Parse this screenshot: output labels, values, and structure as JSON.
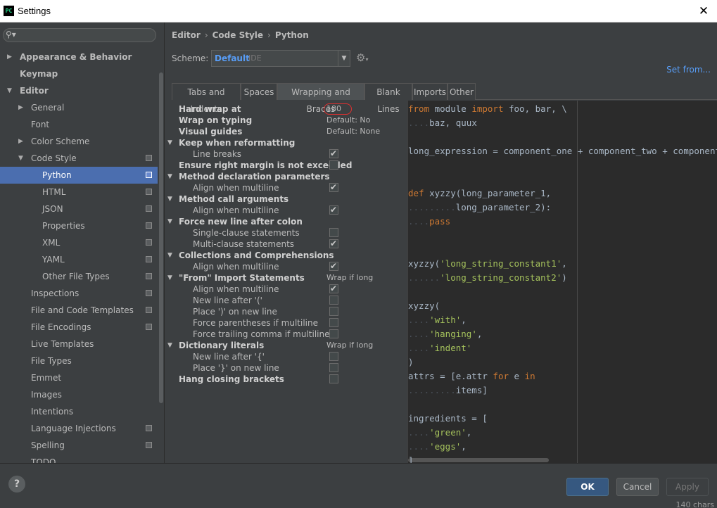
{
  "window": {
    "title": "Settings",
    "app_icon_text": "PC"
  },
  "search": {
    "placeholder": ""
  },
  "tree": [
    {
      "label": "Appearance & Behavior",
      "bold": true,
      "indent": 0,
      "arrow": "right",
      "proj": false
    },
    {
      "label": "Keymap",
      "bold": true,
      "indent": 0,
      "arrow": "",
      "proj": false
    },
    {
      "label": "Editor",
      "bold": true,
      "indent": 0,
      "arrow": "down",
      "proj": false
    },
    {
      "label": "General",
      "bold": false,
      "indent": 1,
      "arrow": "right",
      "proj": false
    },
    {
      "label": "Font",
      "bold": false,
      "indent": 1,
      "arrow": "",
      "proj": false
    },
    {
      "label": "Color Scheme",
      "bold": false,
      "indent": 1,
      "arrow": "right",
      "proj": false
    },
    {
      "label": "Code Style",
      "bold": false,
      "indent": 1,
      "arrow": "down",
      "proj": true
    },
    {
      "label": "Python",
      "bold": false,
      "indent": 2,
      "arrow": "",
      "proj": true,
      "selected": true
    },
    {
      "label": "HTML",
      "bold": false,
      "indent": 2,
      "arrow": "",
      "proj": true
    },
    {
      "label": "JSON",
      "bold": false,
      "indent": 2,
      "arrow": "",
      "proj": true
    },
    {
      "label": "Properties",
      "bold": false,
      "indent": 2,
      "arrow": "",
      "proj": true
    },
    {
      "label": "XML",
      "bold": false,
      "indent": 2,
      "arrow": "",
      "proj": true
    },
    {
      "label": "YAML",
      "bold": false,
      "indent": 2,
      "arrow": "",
      "proj": true
    },
    {
      "label": "Other File Types",
      "bold": false,
      "indent": 2,
      "arrow": "",
      "proj": true
    },
    {
      "label": "Inspections",
      "bold": false,
      "indent": 1,
      "arrow": "",
      "proj": true
    },
    {
      "label": "File and Code Templates",
      "bold": false,
      "indent": 1,
      "arrow": "",
      "proj": true
    },
    {
      "label": "File Encodings",
      "bold": false,
      "indent": 1,
      "arrow": "",
      "proj": true
    },
    {
      "label": "Live Templates",
      "bold": false,
      "indent": 1,
      "arrow": "",
      "proj": false
    },
    {
      "label": "File Types",
      "bold": false,
      "indent": 1,
      "arrow": "",
      "proj": false
    },
    {
      "label": "Emmet",
      "bold": false,
      "indent": 1,
      "arrow": "",
      "proj": false
    },
    {
      "label": "Images",
      "bold": false,
      "indent": 1,
      "arrow": "",
      "proj": false
    },
    {
      "label": "Intentions",
      "bold": false,
      "indent": 1,
      "arrow": "",
      "proj": false
    },
    {
      "label": "Language Injections",
      "bold": false,
      "indent": 1,
      "arrow": "",
      "proj": true
    },
    {
      "label": "Spelling",
      "bold": false,
      "indent": 1,
      "arrow": "",
      "proj": true
    },
    {
      "label": "TODO",
      "bold": false,
      "indent": 1,
      "arrow": "",
      "proj": false
    }
  ],
  "breadcrumb": [
    "Editor",
    "Code Style",
    "Python"
  ],
  "scheme": {
    "label": "Scheme:",
    "value": "Default",
    "suffix": "IDE"
  },
  "set_from": "Set from...",
  "tabs": [
    {
      "label": "Tabs and Indents",
      "active": false
    },
    {
      "label": "Spaces",
      "active": false
    },
    {
      "label": "Wrapping and Braces",
      "active": true
    },
    {
      "label": "Blank Lines",
      "active": false
    },
    {
      "label": "Imports",
      "active": false
    },
    {
      "label": "Other",
      "active": false
    }
  ],
  "options": [
    {
      "label": "Hard wrap at",
      "bold": true,
      "level": 0,
      "toggle": false,
      "value": "180"
    },
    {
      "label": "Wrap on typing",
      "bold": true,
      "level": 0,
      "toggle": false,
      "value": "Default: No"
    },
    {
      "label": "Visual guides",
      "bold": true,
      "level": 0,
      "toggle": false,
      "value": "Default: None"
    },
    {
      "label": "Keep when reformatting",
      "bold": true,
      "level": 0,
      "toggle": true
    },
    {
      "label": "Line breaks",
      "bold": false,
      "level": 1,
      "check": true
    },
    {
      "label": "Ensure right margin is not exceeded",
      "bold": true,
      "level": 0,
      "check": false
    },
    {
      "label": "Method declaration parameters",
      "bold": true,
      "level": 0,
      "toggle": true
    },
    {
      "label": "Align when multiline",
      "bold": false,
      "level": 1,
      "check": true
    },
    {
      "label": "Method call arguments",
      "bold": true,
      "level": 0,
      "toggle": true
    },
    {
      "label": "Align when multiline",
      "bold": false,
      "level": 1,
      "check": true
    },
    {
      "label": "Force new line after colon",
      "bold": true,
      "level": 0,
      "toggle": true
    },
    {
      "label": "Single-clause statements",
      "bold": false,
      "level": 1,
      "check": false
    },
    {
      "label": "Multi-clause statements",
      "bold": false,
      "level": 1,
      "check": true
    },
    {
      "label": "Collections and Comprehensions",
      "bold": true,
      "level": 0,
      "toggle": true
    },
    {
      "label": "Align when multiline",
      "bold": false,
      "level": 1,
      "check": true
    },
    {
      "label": "\"From\" Import Statements",
      "bold": true,
      "level": 0,
      "toggle": true,
      "value": "Wrap if long"
    },
    {
      "label": "Align when multiline",
      "bold": false,
      "level": 1,
      "check": true
    },
    {
      "label": "New line after '('",
      "bold": false,
      "level": 1,
      "check": false
    },
    {
      "label": "Place ')' on new line",
      "bold": false,
      "level": 1,
      "check": false
    },
    {
      "label": "Force parentheses if multiline",
      "bold": false,
      "level": 1,
      "check": false
    },
    {
      "label": "Force trailing comma if multiline",
      "bold": false,
      "level": 1,
      "check": false
    },
    {
      "label": "Dictionary literals",
      "bold": true,
      "level": 0,
      "toggle": true,
      "value": "Wrap if long"
    },
    {
      "label": "New line after '{'",
      "bold": false,
      "level": 1,
      "check": false
    },
    {
      "label": "Place '}' on new line",
      "bold": false,
      "level": 1,
      "check": false
    },
    {
      "label": "Hang closing brackets",
      "bold": true,
      "level": 0,
      "check": false
    }
  ],
  "code_lines": [
    [
      [
        "kw",
        "from"
      ],
      [
        "t",
        " module "
      ],
      [
        "kw",
        "import"
      ],
      [
        "t",
        " foo, bar, \\"
      ]
    ],
    [
      [
        "d",
        "...."
      ],
      [
        "t",
        "baz, quux"
      ]
    ],
    [],
    [
      [
        "t",
        "long_expression = component_one + component_two + component_three"
      ]
    ],
    [],
    [],
    [
      [
        "kw",
        "def"
      ],
      [
        "t",
        " xyzzy(long_parameter_1,"
      ]
    ],
    [
      [
        "d",
        "........."
      ],
      [
        "t",
        "long_parameter_2):"
      ]
    ],
    [
      [
        "d",
        "...."
      ],
      [
        "kw",
        "pass"
      ]
    ],
    [],
    [],
    [
      [
        "t",
        "xyzzy("
      ],
      [
        "st",
        "'long_string_constant1'"
      ],
      [
        "t",
        ","
      ]
    ],
    [
      [
        "d",
        "......"
      ],
      [
        "st",
        "'long_string_constant2'"
      ],
      [
        "t",
        ")"
      ]
    ],
    [],
    [
      [
        "t",
        "xyzzy("
      ]
    ],
    [
      [
        "d",
        "...."
      ],
      [
        "st",
        "'with'"
      ],
      [
        "t",
        ","
      ]
    ],
    [
      [
        "d",
        "...."
      ],
      [
        "st",
        "'hanging'"
      ],
      [
        "t",
        ","
      ]
    ],
    [
      [
        "d",
        "...."
      ],
      [
        "st",
        "'indent'"
      ]
    ],
    [
      [
        "t",
        ")"
      ]
    ],
    [
      [
        "t",
        "attrs = [e.attr "
      ],
      [
        "kw",
        "for"
      ],
      [
        "t",
        " e "
      ],
      [
        "kw",
        "in"
      ]
    ],
    [
      [
        "d",
        "........."
      ],
      [
        "t",
        "items]"
      ]
    ],
    [],
    [
      [
        "t",
        "ingredients = ["
      ]
    ],
    [
      [
        "d",
        "...."
      ],
      [
        "st",
        "'green'"
      ],
      [
        "t",
        ","
      ]
    ],
    [
      [
        "d",
        "...."
      ],
      [
        "st",
        "'eggs'"
      ],
      [
        "t",
        ","
      ]
    ],
    [
      [
        "t",
        "]"
      ]
    ]
  ],
  "buttons": {
    "ok": "OK",
    "cancel": "Cancel",
    "apply": "Apply",
    "help": "?"
  },
  "status": {
    "chars": "140 chars"
  }
}
